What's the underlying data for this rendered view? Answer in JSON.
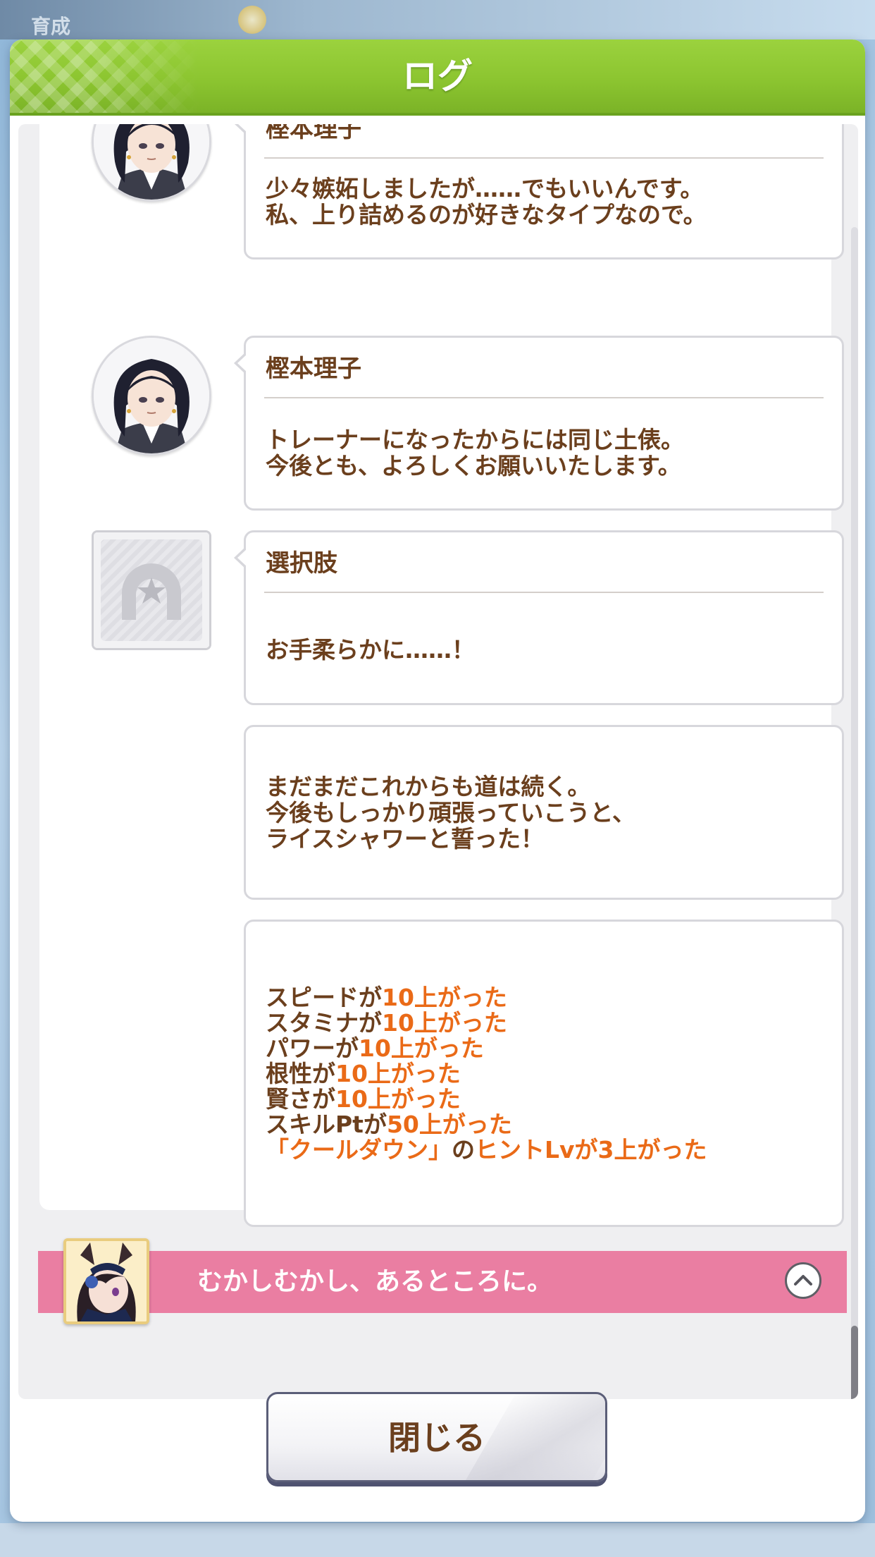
{
  "background": {
    "top_label": "育成"
  },
  "modal": {
    "title": "ログ"
  },
  "entries": [
    {
      "name": "樫本理子",
      "text": "少々嫉妬しましたが……でもいいんです。\n私、上り詰めるのが好きなタイプなので。",
      "icon": "riko-avatar"
    },
    {
      "name": "樫本理子",
      "text": "トレーナーになったからには同じ土俵。\n今後とも、よろしくお願いいたします。",
      "icon": "riko-avatar"
    },
    {
      "name": "選択肢",
      "text": "お手柔らかに……！",
      "icon": "horseshoe-star-icon"
    },
    {
      "name": "",
      "text": "まだまだこれからも道は続く。\n今後もしっかり頑張っていこうと、\nライスシャワーと誓った！"
    }
  ],
  "results": [
    {
      "label": "スピードが",
      "value": "10上がった"
    },
    {
      "label": "スタミナが",
      "value": "10上がった"
    },
    {
      "label": "パワーが",
      "value": "10上がった"
    },
    {
      "label": "根性が",
      "value": "10上がった"
    },
    {
      "label": "賢さが",
      "value": "10上がった"
    },
    {
      "label": "スキルPtが",
      "value": "50上がった"
    }
  ],
  "hint_result": {
    "skill": "「クールダウン」",
    "connector": "の",
    "value": "ヒントLvが3上がった"
  },
  "story": {
    "title": "むかしむかし、あるところに。",
    "portrait_icon": "rice-shower-portrait",
    "toggle_icon": "chevron-up-icon"
  },
  "footer": {
    "close_label": "閉じる"
  },
  "colors": {
    "text_brown": "#6b3f1d",
    "highlight_orange": "#ea6a17",
    "header_green": "#8cc530",
    "story_pink": "#ea7ea2"
  }
}
